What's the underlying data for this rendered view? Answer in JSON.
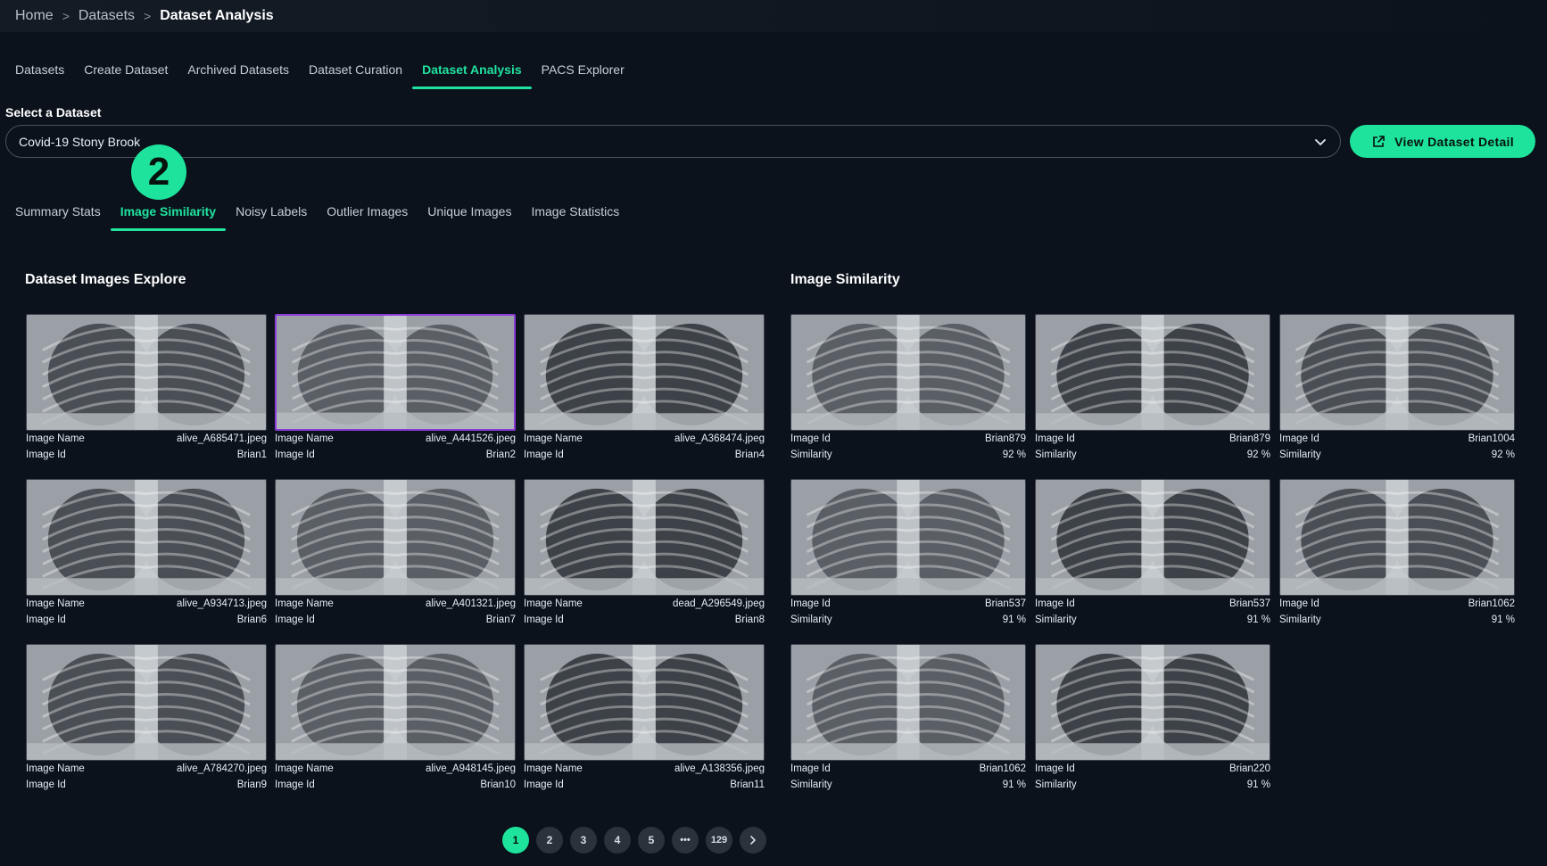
{
  "breadcrumb": {
    "home": "Home",
    "datasets": "Datasets",
    "current": "Dataset Analysis",
    "separator": ">"
  },
  "main_tabs": [
    {
      "label": "Datasets"
    },
    {
      "label": "Create Dataset"
    },
    {
      "label": "Archived Datasets"
    },
    {
      "label": "Dataset Curation"
    },
    {
      "label": "Dataset Analysis",
      "active": true
    },
    {
      "label": "PACS Explorer"
    }
  ],
  "dataset_select": {
    "label": "Select a Dataset",
    "value": "Covid-19 Stony Brook"
  },
  "view_detail_button": {
    "label": "View Dataset Detail"
  },
  "step_badge": "2",
  "sub_tabs": [
    {
      "label": "Summary Stats"
    },
    {
      "label": "Image Similarity",
      "active": true
    },
    {
      "label": "Noisy Labels"
    },
    {
      "label": "Outlier Images"
    },
    {
      "label": "Unique Images"
    },
    {
      "label": "Image Statistics"
    }
  ],
  "explore": {
    "title": "Dataset Images Explore",
    "name_label": "Image Name",
    "id_label": "Image Id",
    "items": [
      {
        "name": "alive_A685471.jpeg",
        "id": "Brian1"
      },
      {
        "name": "alive_A441526.jpeg",
        "id": "Brian2",
        "selected": true
      },
      {
        "name": "alive_A368474.jpeg",
        "id": "Brian4"
      },
      {
        "name": "alive_A934713.jpeg",
        "id": "Brian6"
      },
      {
        "name": "alive_A401321.jpeg",
        "id": "Brian7"
      },
      {
        "name": "dead_A296549.jpeg",
        "id": "Brian8"
      },
      {
        "name": "alive_A784270.jpeg",
        "id": "Brian9"
      },
      {
        "name": "alive_A948145.jpeg",
        "id": "Brian10"
      },
      {
        "name": "alive_A138356.jpeg",
        "id": "Brian11"
      }
    ]
  },
  "similarity": {
    "title": "Image Similarity",
    "id_label": "Image Id",
    "sim_label": "Similarity",
    "items": [
      {
        "id": "Brian879",
        "similarity": "92 %"
      },
      {
        "id": "Brian879",
        "similarity": "92 %"
      },
      {
        "id": "Brian1004",
        "similarity": "92 %"
      },
      {
        "id": "Brian537",
        "similarity": "91 %"
      },
      {
        "id": "Brian537",
        "similarity": "91 %"
      },
      {
        "id": "Brian1062",
        "similarity": "91 %"
      },
      {
        "id": "Brian1062",
        "similarity": "91 %"
      },
      {
        "id": "Brian220",
        "similarity": "91 %"
      }
    ]
  },
  "pagination": {
    "pages": [
      "1",
      "2",
      "3",
      "4",
      "5"
    ],
    "ellipsis": "•••",
    "last": "129",
    "current": "1"
  },
  "colors": {
    "accent": "#1ee39c",
    "background": "#0b121b",
    "selected_border": "#8a3bd8"
  }
}
